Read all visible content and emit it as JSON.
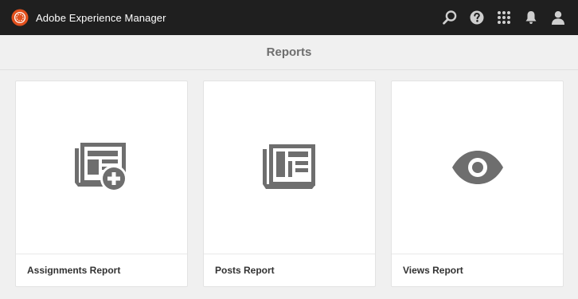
{
  "header": {
    "app_name": "Adobe Experience Manager",
    "actions": [
      {
        "icon": "search-icon"
      },
      {
        "icon": "help-icon"
      },
      {
        "icon": "apps-grid-icon"
      },
      {
        "icon": "bell-icon"
      },
      {
        "icon": "user-icon"
      }
    ]
  },
  "page": {
    "title": "Reports"
  },
  "cards": [
    {
      "label": "Assignments Report",
      "icon": "report-add-icon"
    },
    {
      "label": "Posts Report",
      "icon": "newspaper-icon"
    },
    {
      "label": "Views Report",
      "icon": "eye-icon"
    }
  ],
  "colors": {
    "topbar": "#1f1f1f",
    "icon_gray": "#6e6e6e",
    "page_background": "#f0f0f0"
  }
}
